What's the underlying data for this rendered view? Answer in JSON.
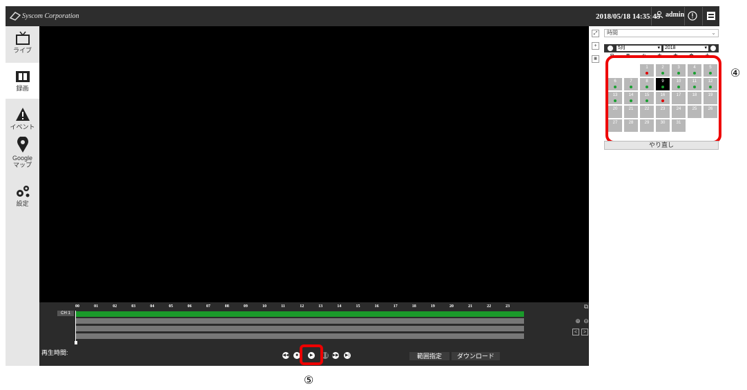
{
  "header": {
    "company": "Syscom Corporation",
    "datetime": "2018/05/18 14:35:45",
    "user": "admin"
  },
  "sidebar": {
    "items": [
      {
        "label": "ライブ",
        "icon": "tv-icon"
      },
      {
        "label": "録画",
        "icon": "film-icon",
        "active": true
      },
      {
        "label": "イベント",
        "icon": "warning-icon"
      },
      {
        "label": "Google\nマップ",
        "icon": "map-pin-icon"
      },
      {
        "label": "設定",
        "icon": "gears-icon"
      }
    ]
  },
  "timeline": {
    "hours": [
      "00",
      "01",
      "02",
      "03",
      "04",
      "05",
      "06",
      "07",
      "08",
      "09",
      "10",
      "11",
      "12",
      "13",
      "14",
      "15",
      "16",
      "17",
      "18",
      "19",
      "20",
      "21",
      "22",
      "23"
    ],
    "channel": "CH 1",
    "playtime_label": "再生時間:",
    "range_button": "範囲指定",
    "download_button": "ダウンロード",
    "prev_label": "<",
    "next_label": ">"
  },
  "right_panel": {
    "mode_select": "時間",
    "month": "5月",
    "year": "2018",
    "weekdays": [
      "日",
      "月",
      "火",
      "水",
      "木",
      "金",
      "土"
    ],
    "days": [
      {
        "d": "1",
        "col": 2,
        "row": 0,
        "dot": "red"
      },
      {
        "d": "2",
        "col": 3,
        "row": 0,
        "dot": "green"
      },
      {
        "d": "3",
        "col": 4,
        "row": 0,
        "dot": "green"
      },
      {
        "d": "4",
        "col": 5,
        "row": 0,
        "dot": "green"
      },
      {
        "d": "5",
        "col": 6,
        "row": 0,
        "dot": "green"
      },
      {
        "d": "6",
        "col": 0,
        "row": 1,
        "dot": "green"
      },
      {
        "d": "7",
        "col": 1,
        "row": 1,
        "dot": "green"
      },
      {
        "d": "8",
        "col": 2,
        "row": 1,
        "dot": "green"
      },
      {
        "d": "9",
        "col": 3,
        "row": 1,
        "dot": "green",
        "today": true
      },
      {
        "d": "10",
        "col": 4,
        "row": 1,
        "dot": "green"
      },
      {
        "d": "11",
        "col": 5,
        "row": 1,
        "dot": "green"
      },
      {
        "d": "12",
        "col": 6,
        "row": 1,
        "dot": "green"
      },
      {
        "d": "13",
        "col": 0,
        "row": 2,
        "dot": "green"
      },
      {
        "d": "14",
        "col": 1,
        "row": 2,
        "dot": "green"
      },
      {
        "d": "15",
        "col": 2,
        "row": 2,
        "dot": "green"
      },
      {
        "d": "16",
        "col": 3,
        "row": 2,
        "dot": "red"
      },
      {
        "d": "17",
        "col": 4,
        "row": 2
      },
      {
        "d": "18",
        "col": 5,
        "row": 2
      },
      {
        "d": "19",
        "col": 6,
        "row": 2
      },
      {
        "d": "20",
        "col": 0,
        "row": 3
      },
      {
        "d": "21",
        "col": 1,
        "row": 3
      },
      {
        "d": "22",
        "col": 2,
        "row": 3
      },
      {
        "d": "23",
        "col": 3,
        "row": 3
      },
      {
        "d": "24",
        "col": 4,
        "row": 3
      },
      {
        "d": "25",
        "col": 5,
        "row": 3
      },
      {
        "d": "26",
        "col": 6,
        "row": 3
      },
      {
        "d": "27",
        "col": 0,
        "row": 4
      },
      {
        "d": "28",
        "col": 1,
        "row": 4
      },
      {
        "d": "29",
        "col": 2,
        "row": 4
      },
      {
        "d": "30",
        "col": 3,
        "row": 4
      },
      {
        "d": "31",
        "col": 4,
        "row": 4
      }
    ],
    "redo_button": "やり直し"
  },
  "annotations": {
    "calendar_marker": "④",
    "play_marker": "⑤"
  },
  "colors": {
    "topbar": "#2d2d2d",
    "recording_green": "#1a9a2a",
    "highlight_red": "#e00000",
    "dot_red": "#e00000",
    "dot_green": "#18a030"
  }
}
